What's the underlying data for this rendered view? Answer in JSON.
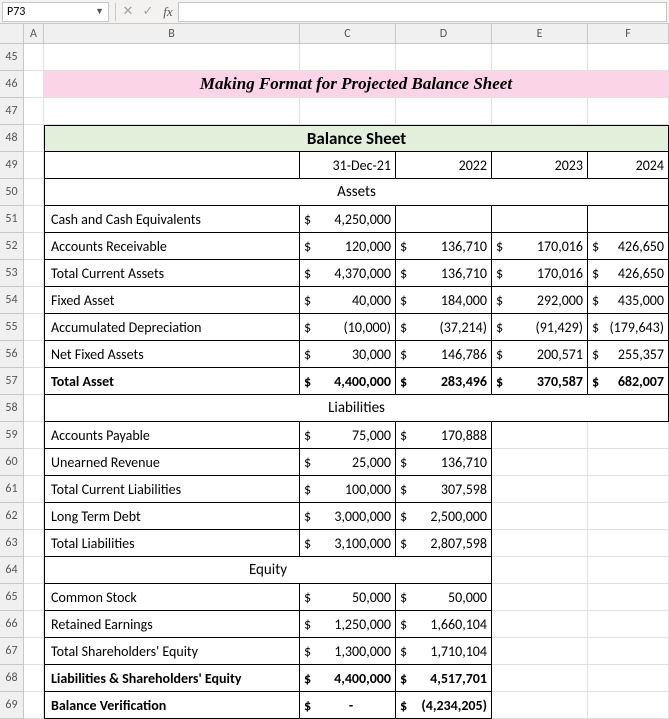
{
  "name_box": "P73",
  "col_headers": [
    "A",
    "B",
    "C",
    "D",
    "E",
    "F"
  ],
  "row_headers": [
    "45",
    "46",
    "47",
    "48",
    "49",
    "50",
    "51",
    "52",
    "53",
    "54",
    "55",
    "56",
    "57",
    "58",
    "59",
    "60",
    "61",
    "62",
    "63",
    "64",
    "65",
    "66",
    "67",
    "68",
    "69"
  ],
  "title": "Making Format for Projected Balance Sheet",
  "balance_sheet_header": "Balance Sheet",
  "years": {
    "c": "31-Dec-21",
    "d": "2022",
    "e": "2023",
    "f": "2024"
  },
  "sections": {
    "assets": "Assets",
    "liabilities": "Liabilities",
    "equity": "Equity"
  },
  "rows": {
    "cash": {
      "label": "Cash and Cash Equivalents",
      "c_sym": "$",
      "c_val": "4,250,000"
    },
    "ar": {
      "label": "Accounts Receivable",
      "c_sym": "$",
      "c_val": "120,000",
      "d_sym": "$",
      "d_val": "136,710",
      "e_sym": "$",
      "e_val": "170,016",
      "f_sym": "$",
      "f_val": "426,650"
    },
    "tca": {
      "label": "Total Current Assets",
      "c_sym": "$",
      "c_val": "4,370,000",
      "d_sym": "$",
      "d_val": "136,710",
      "e_sym": "$",
      "e_val": "170,016",
      "f_sym": "$",
      "f_val": "426,650"
    },
    "fa": {
      "label": "Fixed Asset",
      "c_sym": "$",
      "c_val": "40,000",
      "d_sym": "$",
      "d_val": "184,000",
      "e_sym": "$",
      "e_val": "292,000",
      "f_sym": "$",
      "f_val": "435,000"
    },
    "ad": {
      "label": "Accumulated Depreciation",
      "c_sym": "$",
      "c_val": "(10,000)",
      "d_sym": "$",
      "d_val": "(37,214)",
      "e_sym": "$",
      "e_val": "(91,429)",
      "f_sym": "$",
      "f_val": "(179,643)"
    },
    "nfa": {
      "label": "Net Fixed Assets",
      "c_sym": "$",
      "c_val": "30,000",
      "d_sym": "$",
      "d_val": "146,786",
      "e_sym": "$",
      "e_val": "200,571",
      "f_sym": "$",
      "f_val": "255,357"
    },
    "ta": {
      "label": "Total Asset",
      "c_sym": "$",
      "c_val": "4,400,000",
      "d_sym": "$",
      "d_val": "283,496",
      "e_sym": "$",
      "e_val": "370,587",
      "f_sym": "$",
      "f_val": "682,007"
    },
    "ap": {
      "label": "Accounts Payable",
      "c_sym": "$",
      "c_val": "75,000",
      "d_sym": "$",
      "d_val": "170,888"
    },
    "ur": {
      "label": "Unearned Revenue",
      "c_sym": "$",
      "c_val": "25,000",
      "d_sym": "$",
      "d_val": "136,710"
    },
    "tcl": {
      "label": "Total Current Liabilities",
      "c_sym": "$",
      "c_val": "100,000",
      "d_sym": "$",
      "d_val": "307,598"
    },
    "ltd": {
      "label": "Long Term Debt",
      "c_sym": "$",
      "c_val": "3,000,000",
      "d_sym": "$",
      "d_val": "2,500,000"
    },
    "tl": {
      "label": "Total Liabilities",
      "c_sym": "$",
      "c_val": "3,100,000",
      "d_sym": "$",
      "d_val": "2,807,598"
    },
    "cs": {
      "label": "Common Stock",
      "c_sym": "$",
      "c_val": "50,000",
      "d_sym": "$",
      "d_val": "50,000"
    },
    "re": {
      "label": "Retained Earnings",
      "c_sym": "$",
      "c_val": "1,250,000",
      "d_sym": "$",
      "d_val": "1,660,104"
    },
    "tse": {
      "label": "Total Shareholders' Equity",
      "c_sym": "$",
      "c_val": "1,300,000",
      "d_sym": "$",
      "d_val": "1,710,104"
    },
    "lse": {
      "label": "Liabilities & Shareholders' Equity",
      "c_sym": "$",
      "c_val": "4,400,000",
      "d_sym": "$",
      "d_val": "4,517,701"
    },
    "bv": {
      "label": "Balance Verification",
      "c_sym": "$",
      "c_val": "-",
      "d_sym": "$",
      "d_val": "(4,234,205)"
    }
  },
  "chart_data": {
    "type": "table",
    "title": "Balance Sheet",
    "columns": [
      "31-Dec-21",
      "2022",
      "2023",
      "2024"
    ],
    "series": [
      {
        "name": "Cash and Cash Equivalents",
        "values": [
          4250000,
          null,
          null,
          null
        ]
      },
      {
        "name": "Accounts Receivable",
        "values": [
          120000,
          136710,
          170016,
          426650
        ]
      },
      {
        "name": "Total Current Assets",
        "values": [
          4370000,
          136710,
          170016,
          426650
        ]
      },
      {
        "name": "Fixed Asset",
        "values": [
          40000,
          184000,
          292000,
          435000
        ]
      },
      {
        "name": "Accumulated Depreciation",
        "values": [
          -10000,
          -37214,
          -91429,
          -179643
        ]
      },
      {
        "name": "Net Fixed Assets",
        "values": [
          30000,
          146786,
          200571,
          255357
        ]
      },
      {
        "name": "Total Asset",
        "values": [
          4400000,
          283496,
          370587,
          682007
        ]
      },
      {
        "name": "Accounts Payable",
        "values": [
          75000,
          170888,
          null,
          null
        ]
      },
      {
        "name": "Unearned Revenue",
        "values": [
          25000,
          136710,
          null,
          null
        ]
      },
      {
        "name": "Total Current Liabilities",
        "values": [
          100000,
          307598,
          null,
          null
        ]
      },
      {
        "name": "Long Term Debt",
        "values": [
          3000000,
          2500000,
          null,
          null
        ]
      },
      {
        "name": "Total Liabilities",
        "values": [
          3100000,
          2807598,
          null,
          null
        ]
      },
      {
        "name": "Common Stock",
        "values": [
          50000,
          50000,
          null,
          null
        ]
      },
      {
        "name": "Retained Earnings",
        "values": [
          1250000,
          1660104,
          null,
          null
        ]
      },
      {
        "name": "Total Shareholders' Equity",
        "values": [
          1300000,
          1710104,
          null,
          null
        ]
      },
      {
        "name": "Liabilities & Shareholders' Equity",
        "values": [
          4400000,
          4517701,
          null,
          null
        ]
      },
      {
        "name": "Balance Verification",
        "values": [
          0,
          -4234205,
          null,
          null
        ]
      }
    ]
  }
}
